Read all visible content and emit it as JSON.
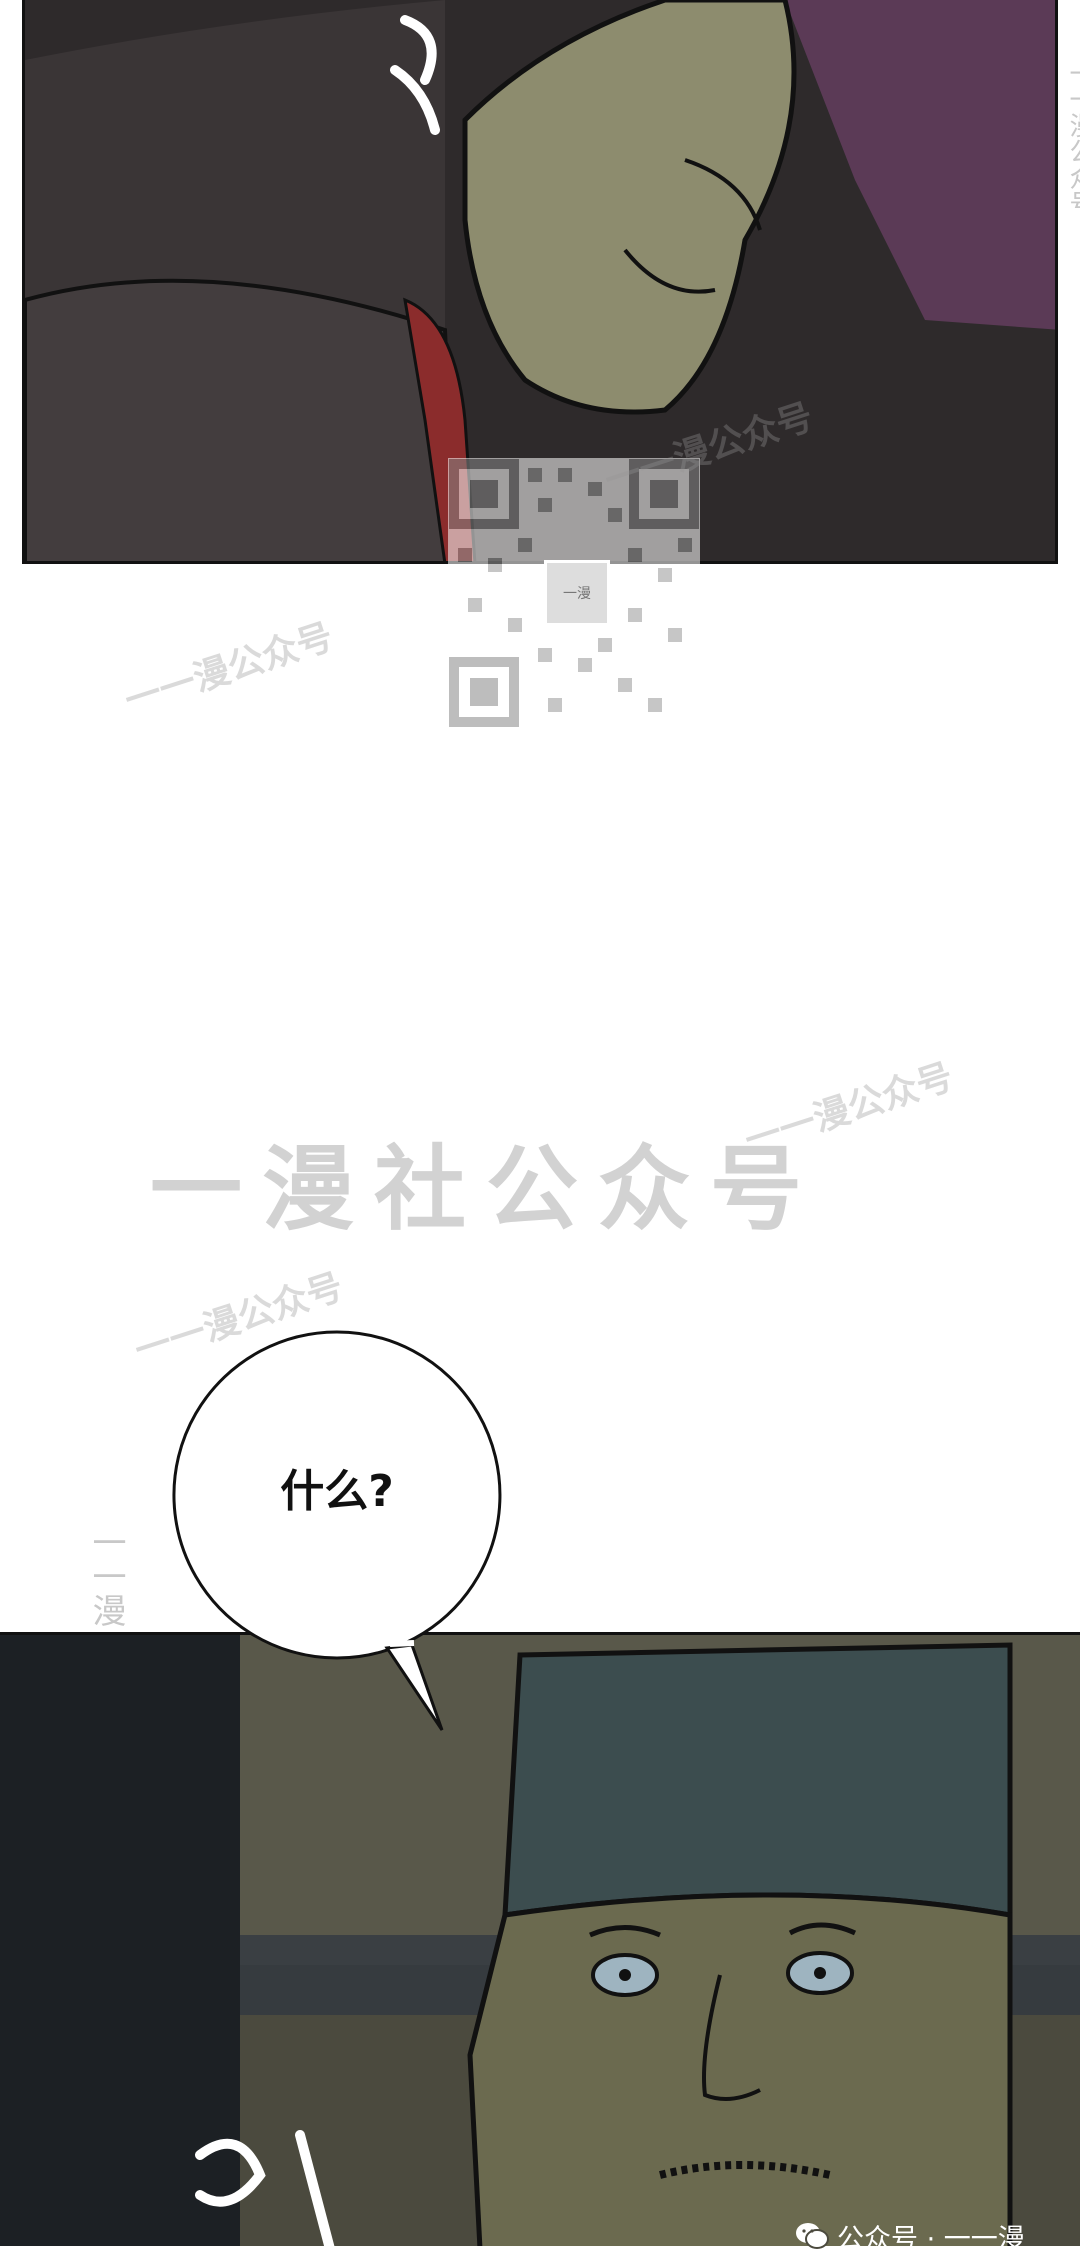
{
  "watermarks": {
    "main": "一漫社公众号",
    "diagonal_a": "一一漫公众号",
    "diagonal_b": "一一漫公众号",
    "diagonal_c": "一一漫公众号",
    "diagonal_d": "一一漫公众号",
    "vertical_left": "一一漫",
    "vertical_right": "一一漫公众号"
  },
  "qr": {
    "center_label": "一漫"
  },
  "speech_bubble": {
    "text": "什么?"
  },
  "footer": {
    "label": "公众号 · 一一漫"
  },
  "colors": {
    "panel_top_bg": "#2e2a2b",
    "panel_top_purple": "#5b3a56",
    "panel_bottom_bg": "#4b4a3e",
    "hat": "#3c4d4f",
    "skin": "#6b6a4f",
    "watermark": "#d2d2d2"
  }
}
